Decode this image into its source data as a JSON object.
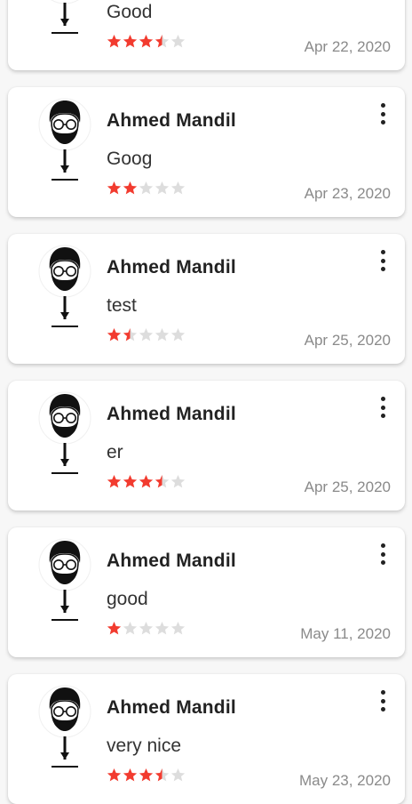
{
  "colors": {
    "star_filled": "#f23b2f",
    "star_empty": "#dddddd",
    "date": "#8a8a8a"
  },
  "icons": {
    "avatar": "man-with-glasses-and-tie-avatar",
    "menu": "more-vertical-icon",
    "rating": "star-icon"
  },
  "reviews": [
    {
      "name": "",
      "comment": "Good",
      "rating": 3.5,
      "date": "Apr 22, 2020"
    },
    {
      "name": "Ahmed Mandil",
      "comment": "Goog",
      "rating": 2,
      "date": "Apr 23, 2020"
    },
    {
      "name": "Ahmed Mandil",
      "comment": "test",
      "rating": 1.5,
      "date": "Apr 25, 2020"
    },
    {
      "name": "Ahmed Mandil",
      "comment": "er",
      "rating": 3.5,
      "date": "Apr 25, 2020"
    },
    {
      "name": "Ahmed Mandil",
      "comment": "good",
      "rating": 1,
      "date": "May 11, 2020"
    },
    {
      "name": "Ahmed Mandil",
      "comment": "very nice",
      "rating": 3.5,
      "date": "May 23, 2020"
    }
  ]
}
